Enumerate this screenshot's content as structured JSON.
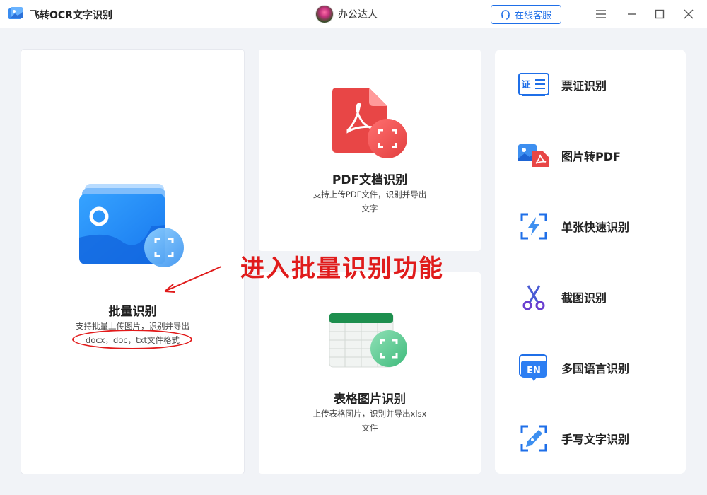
{
  "window": {
    "title": "飞转OCR文字识别",
    "user_name": "办公达人",
    "service_label": "在线客服"
  },
  "cards": {
    "batch": {
      "title": "批量识别",
      "desc_line1": "支持批量上传图片，识别并导出",
      "desc_line2": "docx，doc，txt文件格式"
    },
    "pdf": {
      "title": "PDF文档识别",
      "desc_line1": "支持上传PDF文件，识别并导出",
      "desc_line2": "文字"
    },
    "table": {
      "title": "表格图片识别",
      "desc_line1": "上传表格图片，识别并导出xlsx",
      "desc_line2": "文件"
    }
  },
  "right_menu": [
    {
      "label": "票证识别",
      "icon": "id-card-icon",
      "icon_text": "证"
    },
    {
      "label": "图片转PDF",
      "icon": "image-to-pdf-icon"
    },
    {
      "label": "单张快速识别",
      "icon": "lightning-scan-icon"
    },
    {
      "label": "截图识别",
      "icon": "scissors-icon"
    },
    {
      "label": "多国语言识别",
      "icon": "language-icon",
      "icon_text": "EN"
    },
    {
      "label": "手写文字识别",
      "icon": "pen-scan-icon"
    }
  ],
  "annotation": {
    "text": "进入批量识别功能"
  },
  "colors": {
    "accent": "#1f6fe8",
    "annotation_red": "#e01b1b",
    "pdf_red": "#e84646",
    "table_green": "#1d8f4e"
  }
}
